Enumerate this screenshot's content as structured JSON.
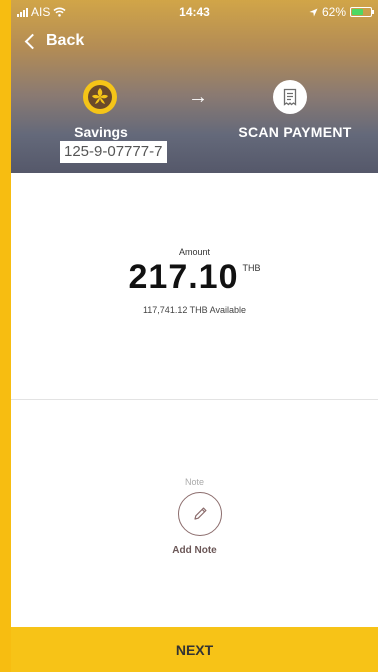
{
  "status_bar": {
    "carrier": "AIS",
    "time": "14:43",
    "battery": "62%",
    "battery_level": 0.62,
    "icons": [
      "signal-icon",
      "wifi-icon",
      "location-arrow-icon",
      "battery-icon"
    ]
  },
  "nav": {
    "back_label": "Back"
  },
  "transfer": {
    "from_label": "Savings",
    "from_account": "125-9-07777-7",
    "to_label": "SCAN PAYMENT",
    "arrow_icon": "arrow-right-icon",
    "bank_icon": "bank-logo-icon",
    "scan_icon": "receipt-icon"
  },
  "amount": {
    "label": "Amount",
    "value": "217.10",
    "currency": "THB",
    "available": "117,741.12 THB Available"
  },
  "note": {
    "label": "Note",
    "add_label": "Add Note",
    "icon": "pencil-icon"
  },
  "footer": {
    "next_label": "NEXT"
  },
  "colors": {
    "accent_yellow": "#f7c317",
    "note_brown": "#6b5757"
  }
}
